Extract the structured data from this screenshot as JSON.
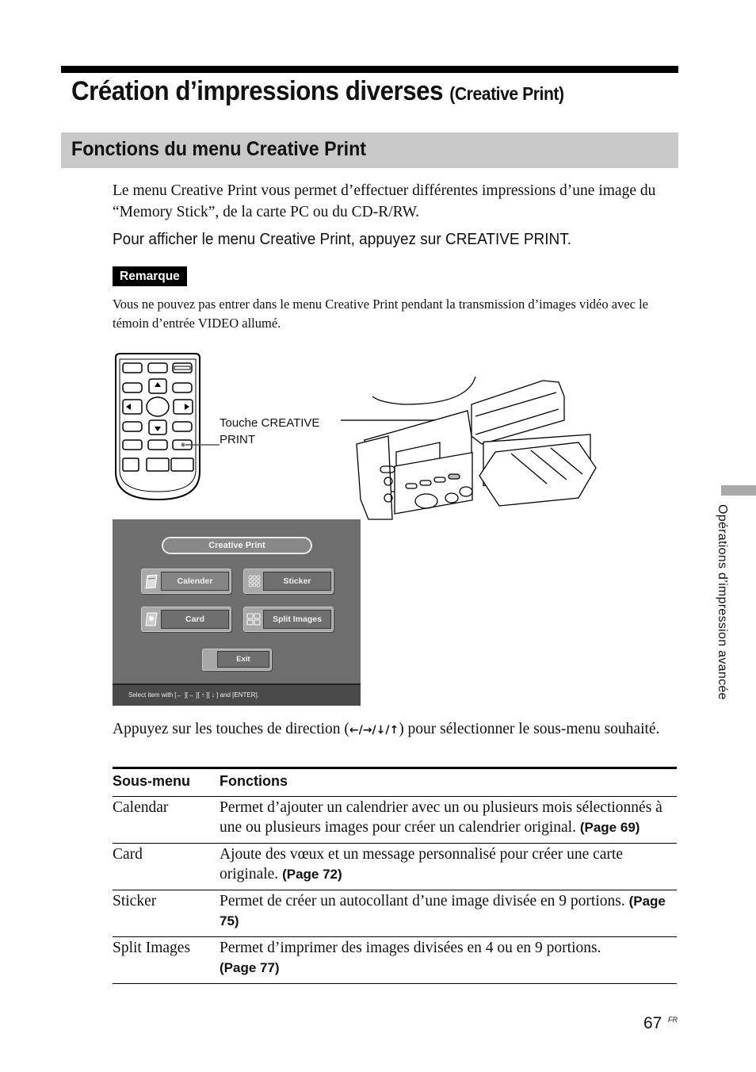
{
  "header": {
    "title": "Création d’impressions diverses",
    "title_sub": "(Creative Print)",
    "section": "Fonctions du menu Creative Print"
  },
  "intro": "Le menu Creative Print vous permet d’effectuer différentes impressions d’une image du “Memory Stick”, de la carte PC ou du CD-R/RW.",
  "instruction": "Pour afficher le menu Creative Print, appuyez sur CREATIVE PRINT.",
  "note": {
    "label": "Remarque",
    "text": "Vous ne pouvez pas entrer dans le menu Creative Print pendant la transmission d’images vidéo avec le témoin d’entrée VIDEO allumé."
  },
  "illustration": {
    "callout_line1": "Touche CREATIVE",
    "callout_line2": "PRINT"
  },
  "screen": {
    "title": "Creative Print",
    "buttons": [
      {
        "label": "Calender",
        "icon": "calendar-icon",
        "selected": true
      },
      {
        "label": "Sticker",
        "icon": "sticker-icon",
        "selected": false
      },
      {
        "label": "Card",
        "icon": "card-icon",
        "selected": false
      },
      {
        "label": "Split Images",
        "icon": "split-images-icon",
        "selected": false
      }
    ],
    "exit_label": "Exit",
    "status": "Select item with [← ][→ ][ ↑ ][ ↓ ] and [ENTER]."
  },
  "direction_text": {
    "before": "Appuyez sur les touches de direction (",
    "arrows": "←/→/↓/↑",
    "after": ") pour sélectionner le sous-menu souhaité."
  },
  "table": {
    "headers": [
      "Sous-menu",
      "Fonctions"
    ],
    "rows": [
      {
        "name": "Calendar",
        "desc": "Permet d’ajouter un calendrier avec un ou plusieurs mois sélectionnés à une ou plusieurs images pour créer un calendrier original.",
        "ref": "(Page 69)"
      },
      {
        "name": "Card",
        "desc": "Ajoute des vœux et un message personnalisé pour créer une carte originale.",
        "ref": "(Page 72)"
      },
      {
        "name": "Sticker",
        "desc": "Permet de créer un autocollant d’une image divisée en 9 portions.",
        "ref": "(Page 75)"
      },
      {
        "name": "Split Images",
        "desc": "Permet d’imprimer des images divisées en 4 ou en 9 portions.",
        "ref": "(Page 77)"
      }
    ]
  },
  "side_tab": "Opérations d’impression avancée",
  "footer": {
    "page": "67",
    "lang": "FR"
  }
}
